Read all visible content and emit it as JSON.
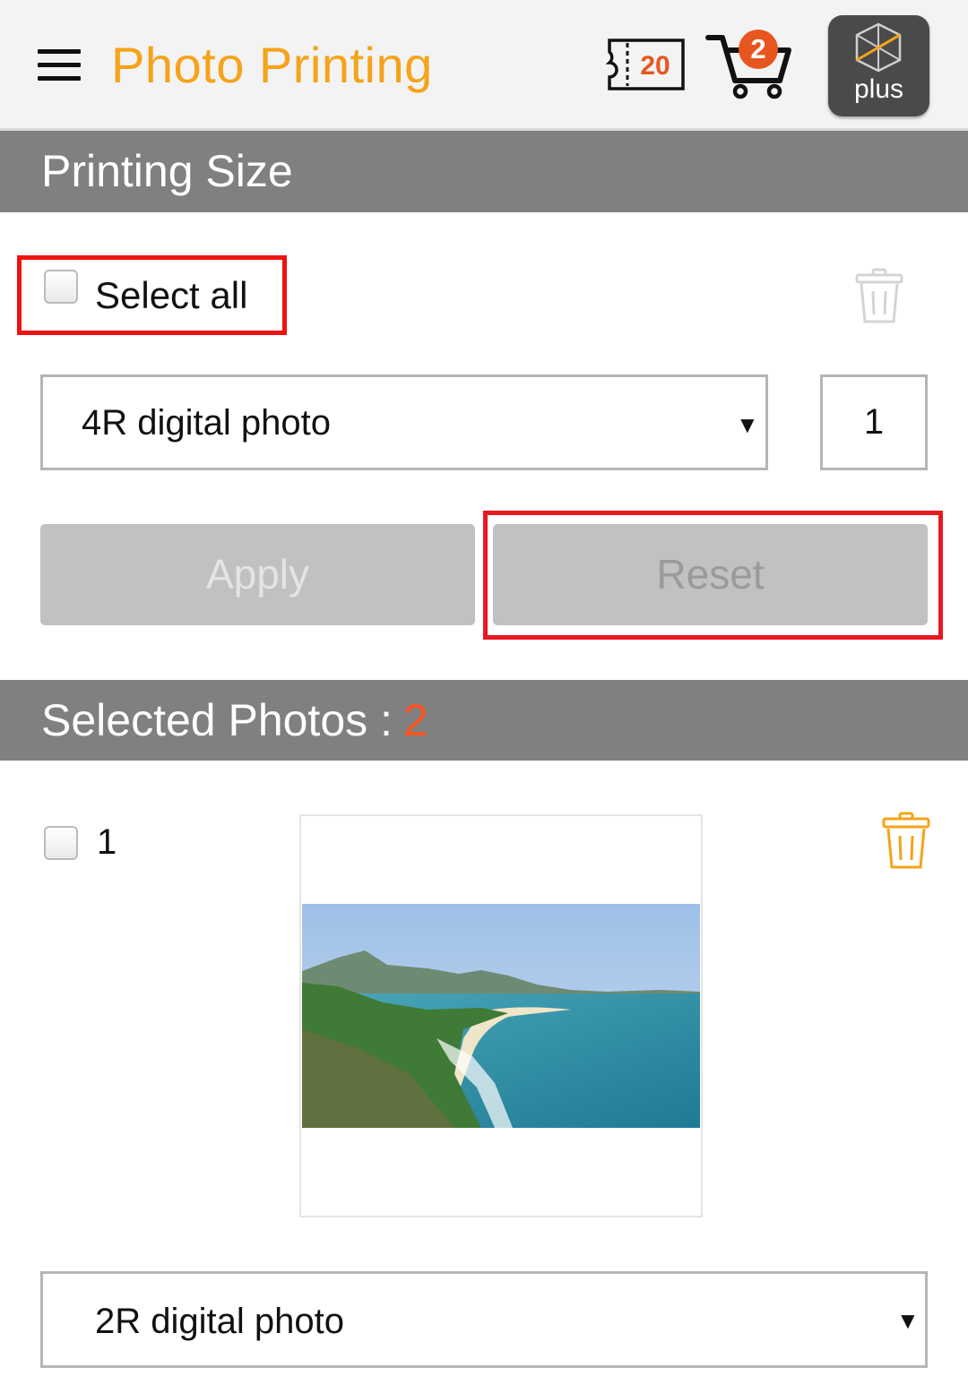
{
  "header": {
    "title": "Photo Printing",
    "coupon_count": "20",
    "cart_count": "2",
    "plus_label": "plus"
  },
  "printing_size": {
    "section_title": "Printing Size",
    "select_all_label": "Select all",
    "size_option": "4R digital photo",
    "quantity": "1",
    "apply_label": "Apply",
    "reset_label": "Reset"
  },
  "selected_photos": {
    "section_title": "Selected Photos :",
    "count": "2",
    "items": [
      {
        "number": "1",
        "size_option": "2R digital photo"
      }
    ]
  },
  "colors": {
    "accent_orange": "#f5a31a",
    "badge": "#e8561f",
    "section_header": "#808080",
    "button_disabled": "#c1c1c1",
    "highlight_frame": "#e61920"
  },
  "icons": [
    "menu-icon",
    "coupon-icon",
    "cart-icon",
    "plus-logo-icon",
    "trash-icon",
    "dropdown-arrow-icon"
  ]
}
